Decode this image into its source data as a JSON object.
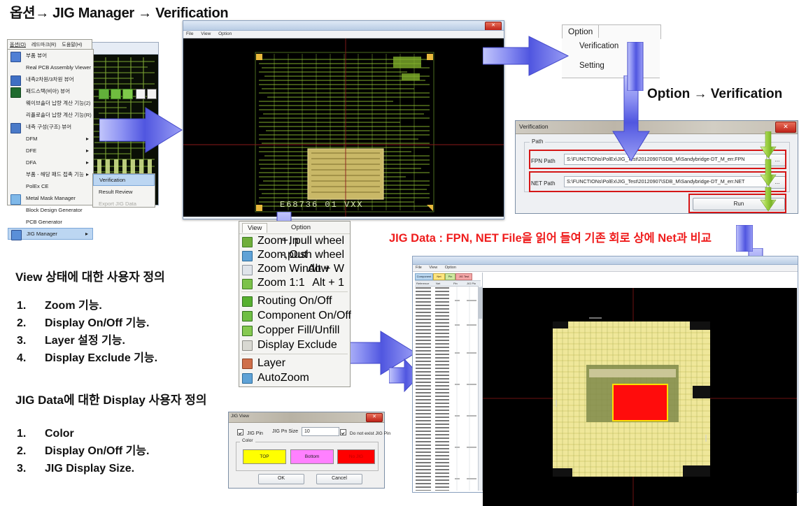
{
  "slide": {
    "title": "옵션→ JIG Manager → Verification",
    "caption_option_verification": "Option → Verification",
    "red_banner": "JIG Data : FPN, NET File을 읽어 들여 기존 회로 상에 Net과 비교"
  },
  "pollex_menu": {
    "menubar": [
      "옵션(O)",
      "레드마크(R)",
      "도움말(H)"
    ],
    "items": [
      {
        "label": "부품 뷰어",
        "icon": true,
        "submenu": false
      },
      {
        "label": "Real PCB Assembly Viewer",
        "icon": false,
        "submenu": false
      },
      {
        "label": "내측2차원/3차원 뷰어",
        "icon": true,
        "submenu": false
      },
      {
        "label": "패드스택(비아) 뷰어",
        "icon": true,
        "submenu": false
      },
      {
        "label": "웨이브솔더 납량 계산 기능(2)",
        "icon": false,
        "submenu": false
      },
      {
        "label": "리플로솔더 납량 계산 기능(R)",
        "icon": false,
        "submenu": false
      },
      {
        "label": "내측 구성(구조) 뷰어",
        "icon": true,
        "submenu": false
      },
      {
        "label": "DFM",
        "icon": false,
        "submenu": true
      },
      {
        "label": "DFE",
        "icon": false,
        "submenu": true
      },
      {
        "label": "DFA",
        "icon": false,
        "submenu": true
      },
      {
        "label": "부품 - 해당 패드 접촉 기능",
        "icon": false,
        "submenu": true
      },
      {
        "label": "PolEx CE",
        "icon": false,
        "submenu": false
      },
      {
        "label": "Metal Mask Manager",
        "icon": true,
        "submenu": false
      },
      {
        "label": "Block Design Generator",
        "icon": false,
        "submenu": false
      },
      {
        "label": "PCB Generator",
        "icon": false,
        "submenu": false
      },
      {
        "label": "JIG Manager",
        "icon": true,
        "submenu": true,
        "selected": true
      }
    ],
    "submenu_items": [
      {
        "label": "Verification",
        "selected": true,
        "disabled": false
      },
      {
        "label": "Result Review",
        "selected": false,
        "disabled": false
      },
      {
        "label": "Export JIG Data",
        "selected": false,
        "disabled": true
      }
    ]
  },
  "pcb_viewer_top": {
    "menubar": [
      "File",
      "View",
      "Option"
    ],
    "board_label": "E68736 01 VXX"
  },
  "option_tabs": {
    "tab_label": "Option",
    "items": [
      "Verification",
      "Setting"
    ]
  },
  "verification_dialog": {
    "title": "Verification",
    "close_label": "✕",
    "group_label": "Path",
    "fpn_label": "FPN Path",
    "fpn_value": "S:\\FUNCTIONs\\PolEx\\JIG_Test\\20120907\\SDB_M\\Sandybridge-DT_M_err.FPN",
    "net_label": "NET Path",
    "net_value": "S:\\FUNCTIONs\\PolEx\\JIG_Test\\20120907\\SDB_M\\Sandybridge-DT_M_err.NET",
    "browse_label": "...",
    "run_label": "Run"
  },
  "view_menu": {
    "tabs": [
      "View",
      "Option"
    ],
    "items": [
      {
        "label": "Zoom In",
        "accel": "+, pull wheel"
      },
      {
        "label": "Zoom Out",
        "accel": "-,push wheel"
      },
      {
        "label": "Zoom Window",
        "accel": "Alt + W"
      },
      {
        "label": "Zoom 1:1",
        "accel": "Alt + 1"
      },
      {
        "label": "Routing On/Off",
        "accel": ""
      },
      {
        "label": "Component On/Off",
        "accel": ""
      },
      {
        "label": "Copper Fill/Unfill",
        "accel": ""
      },
      {
        "label": "Display Exclude",
        "accel": ""
      },
      {
        "label": "Layer",
        "accel": ""
      },
      {
        "label": "AutoZoom",
        "accel": ""
      }
    ]
  },
  "view_text_block": {
    "heading": "View 상태에 대한 사용자 정의",
    "items": [
      {
        "num": "1.",
        "label": "Zoom 기능."
      },
      {
        "num": "2.",
        "label": "Display On/Off 기능."
      },
      {
        "num": "3.",
        "label": "Layer 설정 기능."
      },
      {
        "num": "4.",
        "label": "Display Exclude 기능."
      }
    ]
  },
  "jig_text_block": {
    "heading": "JIG Data에 대한 Display 사용자 정의",
    "items": [
      {
        "num": "1.",
        "label": "Color"
      },
      {
        "num": "2.",
        "label": "Display On/Off 기능."
      },
      {
        "num": "3.",
        "label": "JIG Display Size."
      }
    ]
  },
  "jig_view_dialog": {
    "title": "JIG View",
    "close_label": "✕",
    "jig_pin_checkbox": "JIG Pin",
    "jig_pin_size_label": "JIG Pn Size",
    "jig_pin_size_value": "10",
    "do_not_exist_checkbox": "Do not exist JIG Pin",
    "color_group": "Color",
    "swatches": [
      {
        "label": "TOP",
        "color": "#ffff00"
      },
      {
        "label": "Bottom",
        "color": "#ff80ff"
      },
      {
        "label": "No JIG",
        "color": "#ff0000"
      }
    ],
    "ok_label": "OK",
    "cancel_label": "Cancel"
  },
  "result_window": {
    "menubar": [
      "File",
      "View",
      "Option"
    ],
    "toolbar_buttons": [
      {
        "label": "Component",
        "color": "#b9d6ef"
      },
      {
        "label": "Net",
        "color": "#ffe680"
      },
      {
        "label": "Pin",
        "color": "#cfe8a0"
      },
      {
        "label": "JIG Test",
        "color": "#f4a7a7"
      }
    ],
    "columns": [
      "Reference",
      "Net",
      "Pin",
      "JIG Pin"
    ]
  },
  "colors": {
    "arrow_blue": "#6f74e8",
    "arrow_green": "#9dd545",
    "highlight_red": "#d51616",
    "banner_red": "#ef1c1c",
    "pcb_green": "#8fbe3a"
  }
}
